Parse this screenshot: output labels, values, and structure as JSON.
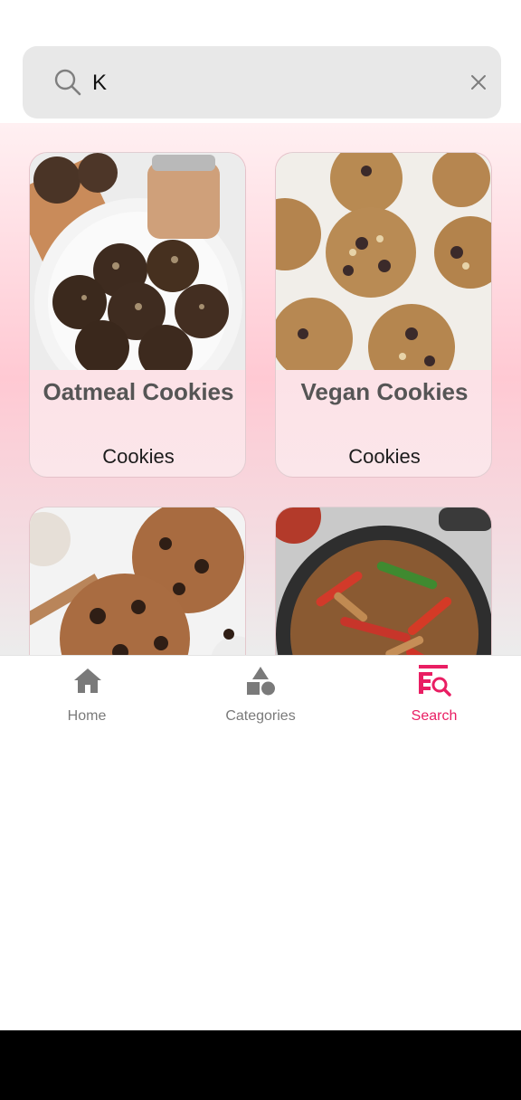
{
  "search": {
    "value": "K",
    "icon": "search-icon",
    "clear_icon": "close-icon"
  },
  "results": [
    {
      "title": "Oatmeal Cookies",
      "category": "Cookies",
      "image": "oatmeal-cookies-photo"
    },
    {
      "title": "Vegan Cookies",
      "category": "Cookies",
      "image": "vegan-cookies-photo"
    },
    {
      "title": "",
      "category": "",
      "image": "chocolate-chip-cookies-photo"
    },
    {
      "title": "",
      "category": "",
      "image": "chicken-fajita-skillet-photo"
    }
  ],
  "nav": {
    "items": [
      {
        "label": "Home",
        "icon": "home-icon",
        "active": false
      },
      {
        "label": "Categories",
        "icon": "shapes-icon",
        "active": false
      },
      {
        "label": "Search",
        "icon": "search-list-icon",
        "active": true
      }
    ]
  },
  "colors": {
    "accent": "#e91e63",
    "inactive": "#7a7a7a",
    "search_bg": "#e8e8e8"
  }
}
